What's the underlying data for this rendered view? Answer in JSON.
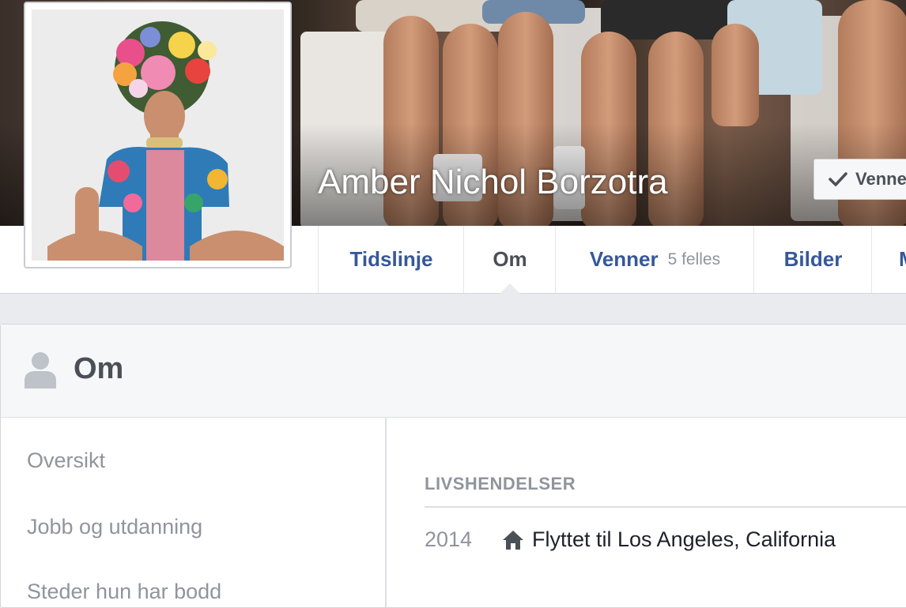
{
  "profile": {
    "name": "Amber Nichol Borzotra",
    "friends_button_label": "Venner"
  },
  "tabs": [
    {
      "label": "Tidslinje",
      "active": false
    },
    {
      "label": "Om",
      "active": true
    },
    {
      "label": "Venner",
      "count": "5 felles",
      "active": false
    },
    {
      "label": "Bilder",
      "active": false
    },
    {
      "label": "M",
      "active": false
    }
  ],
  "about": {
    "title": "Om",
    "sidebar": [
      {
        "label": "Oversikt"
      },
      {
        "label": "Jobb og utdanning"
      },
      {
        "label": "Steder hun har bodd"
      }
    ],
    "section_title": "LIVSHENDELSER",
    "events": [
      {
        "year": "2014",
        "icon": "home-icon",
        "text": "Flyttet til Los Angeles, California"
      }
    ]
  },
  "colors": {
    "link": "#365899",
    "muted": "#90949c",
    "text": "#1d2129",
    "background": "#e9ebee"
  }
}
